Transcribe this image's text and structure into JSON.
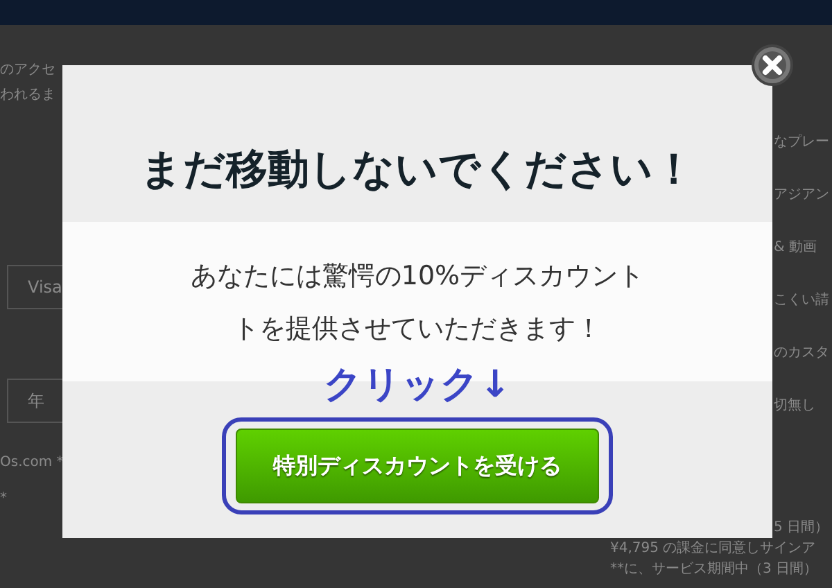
{
  "background": {
    "left_texts": [
      {
        "kind": "text",
        "text": "のアクセ"
      },
      {
        "kind": "text",
        "text": "われるま"
      },
      {
        "kind": "select",
        "text": "Visa"
      },
      {
        "kind": "select",
        "text": "年"
      },
      {
        "kind": "text",
        "text": "Os.com *"
      },
      {
        "kind": "text",
        "text": "*"
      }
    ],
    "right_texts": [
      "なプレー",
      "アジアン",
      "& 動画",
      "こくい請",
      "のカスタ",
      "切無し",
      "5 日間）"
    ],
    "bottom_texts": [
      "¥4,795 の課金に同意しサインア",
      "**に、サービス期間中（3 日間）"
    ]
  },
  "modal": {
    "title": "まだ移動しないでください！",
    "body_lines": [
      "あなたには驚愕の10%ディスカウント",
      "トを提供させていただきます！"
    ],
    "annotation": "クリック↓",
    "button": "特別ディスカウントを受ける"
  }
}
